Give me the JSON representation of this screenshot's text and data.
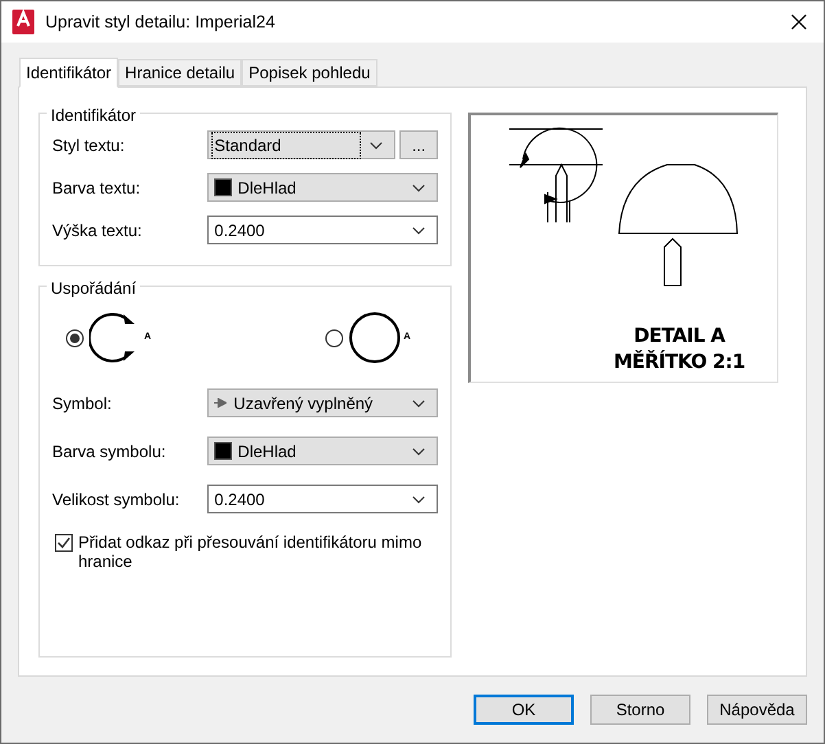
{
  "window": {
    "title": "Upravit styl detailu: Imperial24"
  },
  "tabs": [
    {
      "label": "Identifikátor",
      "selected": true
    },
    {
      "label": "Hranice detailu",
      "selected": false
    },
    {
      "label": "Popisek pohledu",
      "selected": false
    }
  ],
  "identifier": {
    "legend": "Identifikátor",
    "fields": [
      {
        "kind": "style",
        "label": "Styl textu:",
        "value": "Standard",
        "button": "..."
      },
      {
        "kind": "color",
        "label": "Barva textu:",
        "value": "DleHlad"
      },
      {
        "kind": "combo",
        "label": "Výška textu:",
        "value": "0.2400"
      }
    ]
  },
  "arrangement": {
    "legend": "Uspořádání",
    "options": [
      {
        "kind": "arrows",
        "letter": "A",
        "selected": true
      },
      {
        "kind": "plain",
        "letter": "A",
        "selected": false
      }
    ],
    "fields": [
      {
        "kind": "symbol",
        "label": "Symbol:",
        "value": "Uzavřený vyplněný"
      },
      {
        "kind": "color",
        "label": "Barva symbolu:",
        "value": "DleHlad"
      },
      {
        "kind": "combo",
        "label": "Velikost symbolu:",
        "value": "0.2400"
      }
    ],
    "checkbox": {
      "label": "Přidat odkaz při přesouvání identifikátoru mimo hranice",
      "checked": true
    }
  },
  "preview": {
    "lines": [
      "DETAIL A",
      "MĚŘÍTKO 2:1"
    ]
  },
  "buttons": [
    {
      "label": "OK",
      "default": true
    },
    {
      "label": "Storno",
      "default": false
    },
    {
      "label": "Nápověda",
      "default": false
    }
  ]
}
